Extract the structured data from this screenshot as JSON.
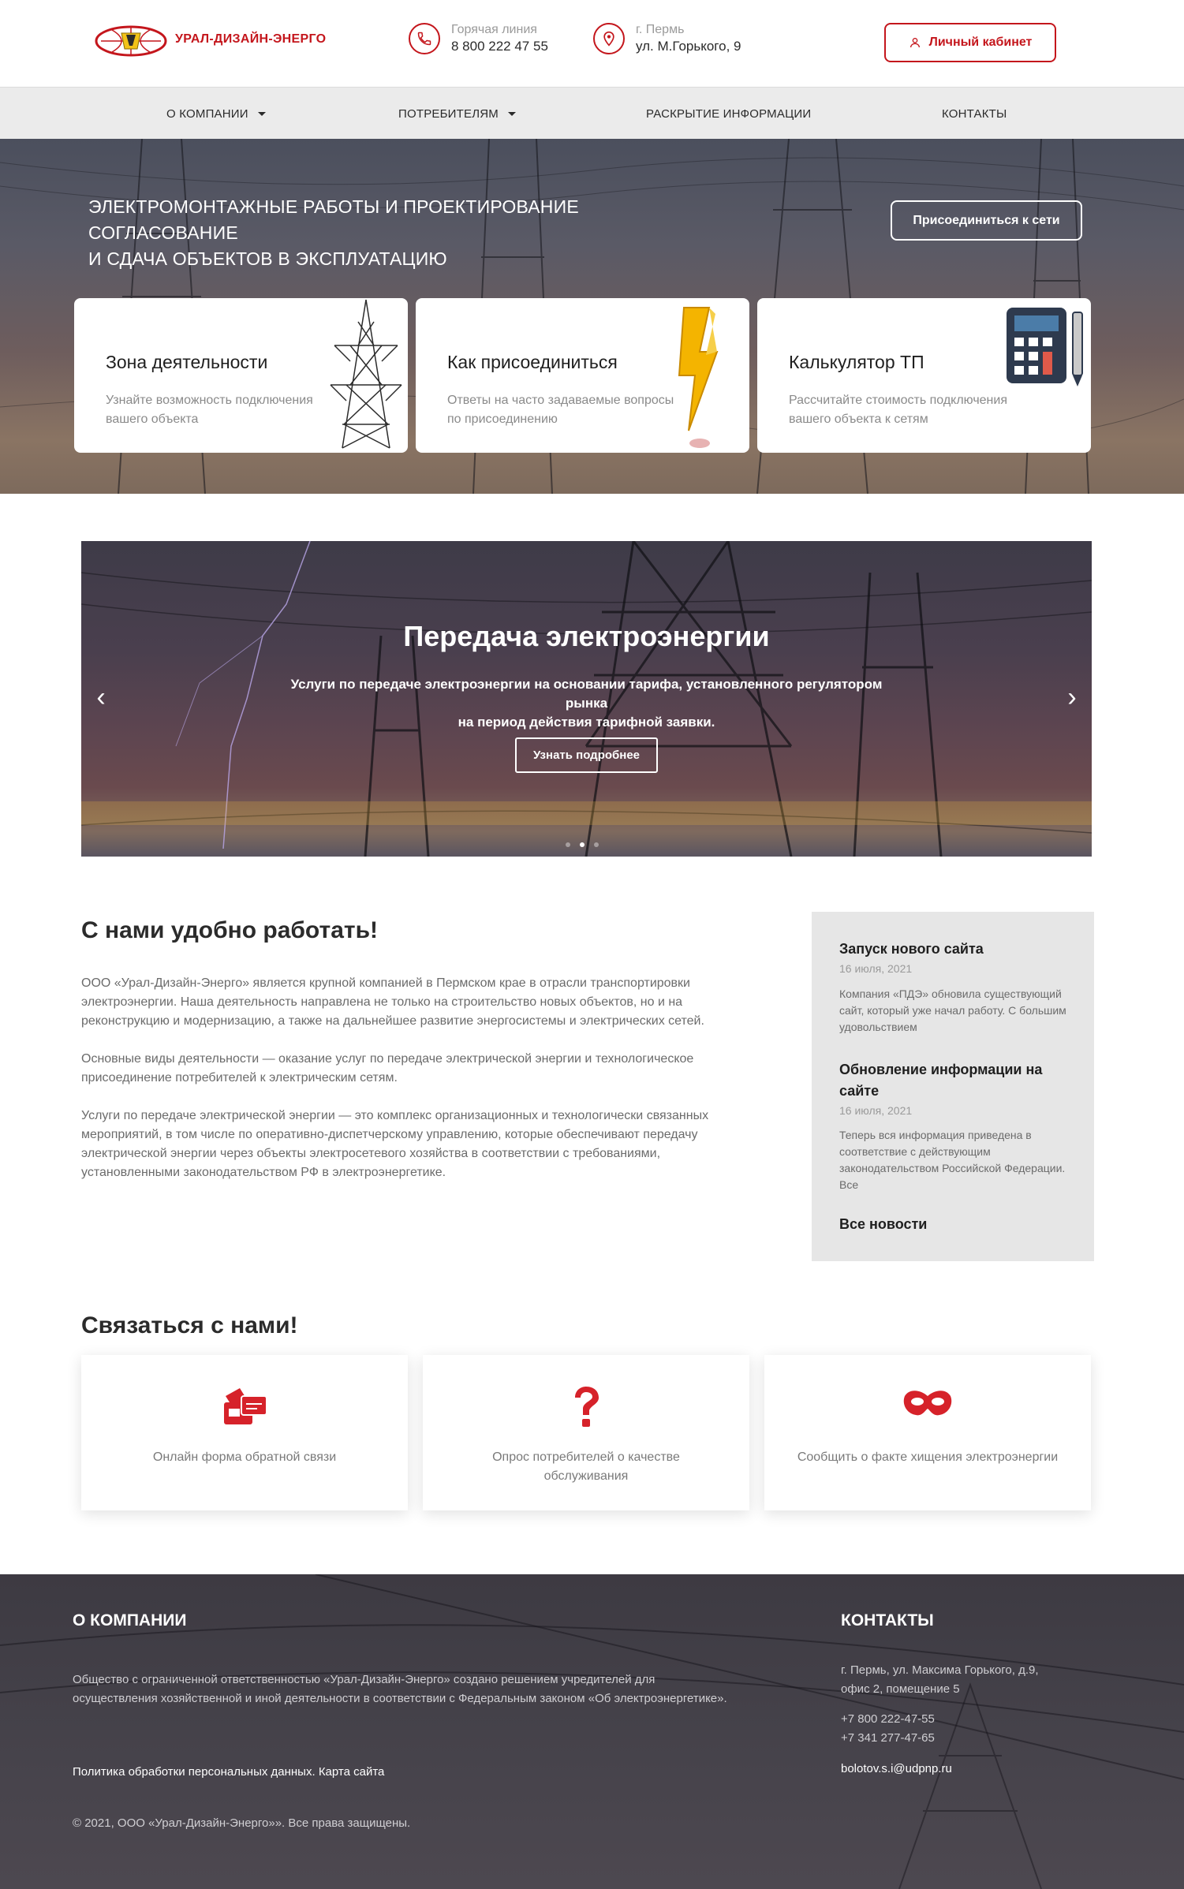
{
  "header": {
    "logo_text": "УРАЛ-ДИЗАЙН-ЭНЕРГО",
    "hotline_label": "Горячая линия",
    "hotline_phone": "8 800 222 47 55",
    "city": "г. Пермь",
    "address": "ул. М.Горького, 9",
    "cabinet_label": "Личный кабинет"
  },
  "nav": {
    "items": [
      {
        "label": "О КОМПАНИИ"
      },
      {
        "label": "ПОТРЕБИТЕЛЯМ"
      },
      {
        "label": "РАСКРЫТИЕ ИНФОРМАЦИИ"
      },
      {
        "label": "КОНТАКТЫ"
      }
    ]
  },
  "hero": {
    "title_line1": "ЭЛЕКТРОМОНТАЖНЫЕ РАБОТЫ И ПРОЕКТИРОВАНИЕ СОГЛАСОВАНИЕ",
    "title_line2": "И СДАЧА ОБЪЕКТОВ В ЭКСПЛУАТАЦИЮ",
    "join_label": "Присоединиться к сети",
    "cards": [
      {
        "title": "Зона деятельности",
        "sub": "Узнайте возможность подключения вашего объекта",
        "icon": "power-tower-icon"
      },
      {
        "title": "Как присоединиться",
        "sub": "Ответы на часто задаваемые вопросы по присоединению",
        "icon": "lightning-icon"
      },
      {
        "title": "Калькулятор ТП",
        "sub": "Рассчитайте стоимость подключения вашего объекта к сетям",
        "icon": "calculator-icon"
      }
    ]
  },
  "slider": {
    "title": "Передача электроэнергии",
    "text_line1": "Услуги по передаче электроэнергии на основании тарифа, установленного регулятором рынка",
    "text_line2": "на период действия тарифной заявки.",
    "button": "Узнать подробнее",
    "dots_total": 3,
    "dots_active": 2
  },
  "about": {
    "heading": "С нами удобно работать!",
    "p1": "ООО «Урал-Дизайн-Энерго» является крупной компанией в Пермском крае в отрасли транспортировки электроэнергии. Наша деятельность направлена не только на строительство новых объектов, но и на реконструкцию и модернизацию, а также на дальнейшее развитие энергосистемы и электрических сетей.",
    "p2": "Основные виды деятельности — оказание услуг по передаче электрической энергии и технологическое присоединение потребителей к электрическим сетям.",
    "p3": "Услуги по передаче электрической энергии — это комплекс организационных и технологически связанных мероприятий, в том числе по оперативно-диспетчерскому управлению, которые обеспечивают передачу электрической энергии через объекты электросетевого хозяйства в соответствии с требованиями, установленными законодательством РФ в электроэнергетике."
  },
  "news": {
    "items": [
      {
        "title": "Запуск нового сайта",
        "date": "16 июля, 2021",
        "text": "Компания «ПДЭ» обновила существующий сайт, который уже начал работу. С большим удовольствием"
      },
      {
        "title": "Обновление информации на сайте",
        "date": "16 июля, 2021",
        "text": "Теперь вся информация приведена в соответствие с действующим законодательством Российской Федерации. Все"
      }
    ],
    "all_label": "Все новости"
  },
  "contact": {
    "heading": "Связаться с нами!",
    "cards": [
      {
        "label": "Онлайн форма обратной связи",
        "icon": "feedback-form-icon"
      },
      {
        "label": "Опрос потребителей о качестве обслуживания",
        "icon": "question-icon"
      },
      {
        "label": "Сообщить о факте хищения электроэнергии",
        "icon": "mask-icon"
      }
    ]
  },
  "footer": {
    "about_heading": "О КОМПАНИИ",
    "about_text": "Общество с ограниченной ответственностью «Урал-Дизайн-Энерго» создано решением учредителей для осуществления хозяйственной и иной деятельности в соответствии с Федеральным законом «Об электроэнергетике».",
    "policy_link": "Политика обработки персональных данных.",
    "sitemap_link": "Карта сайта",
    "copyright": "© 2021, ООО «Урал-Дизайн-Энерго»». Все права защищены.",
    "contacts_heading": "КОНТАКТЫ",
    "address_line1": "г. Пермь, ул. Максима Горького, д.9,",
    "address_line2": "офис 2, помещение 5",
    "phone1": "+7 800 222-47-55",
    "phone2": "+7 341 277-47-65",
    "email": "bolotov.s.i@udpnp.ru"
  },
  "colors": {
    "accent": "#c4161c",
    "nav_bg": "#ebebeb",
    "news_bg": "#e6e6e6"
  }
}
